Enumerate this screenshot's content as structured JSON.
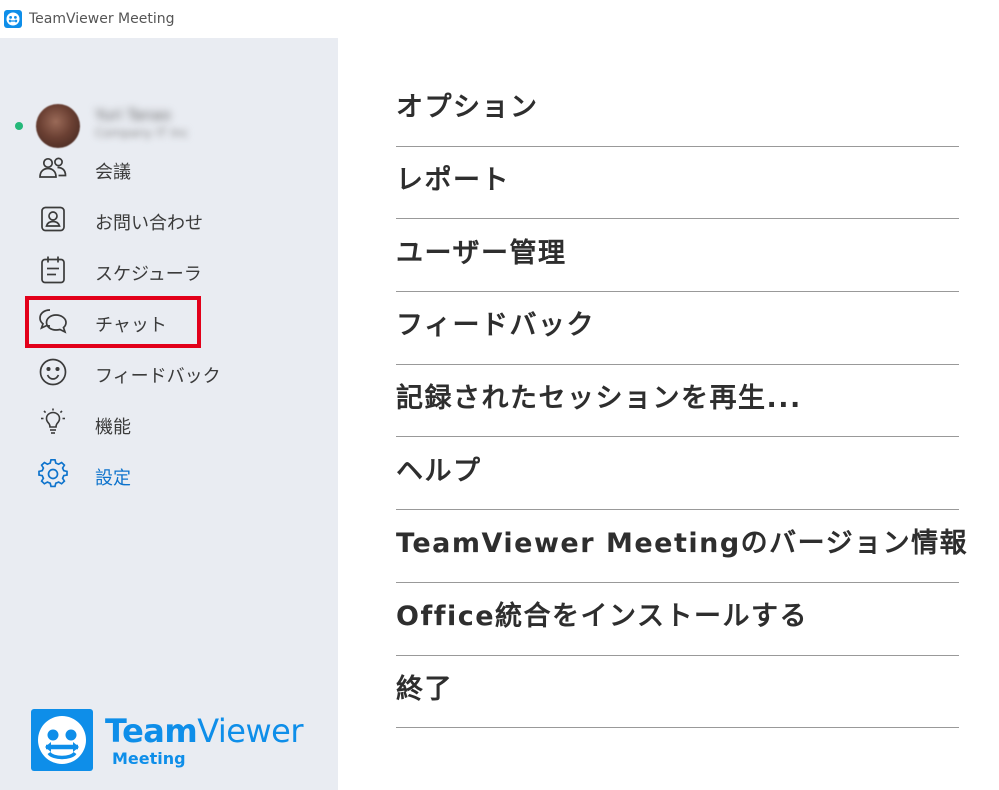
{
  "titlebar": {
    "title": "TeamViewer Meeting",
    "icon": "teamviewer-app-icon"
  },
  "profile": {
    "name": "Yuri Tanao",
    "company": "Company IT Inc",
    "status_color": "#25b87a"
  },
  "sidebar": {
    "items": [
      {
        "label": "会議",
        "icon": "people-icon"
      },
      {
        "label": "お問い合わせ",
        "icon": "contact-card-icon"
      },
      {
        "label": "スケジューラ",
        "icon": "calendar-icon"
      },
      {
        "label": "チャット",
        "icon": "chat-bubbles-icon"
      },
      {
        "label": "フィードバック",
        "icon": "smiley-icon"
      },
      {
        "label": "機能",
        "icon": "lightbulb-icon"
      },
      {
        "label": "設定",
        "icon": "gear-icon",
        "active": true
      }
    ]
  },
  "brand": {
    "word_bold": "Team",
    "word_regular": "Viewer",
    "sub": "Meeting",
    "color": "#0e8ee9"
  },
  "menu": {
    "items": [
      "オプション",
      "レポート",
      "ユーザー管理",
      "フィードバック",
      "記録されたセッションを再生...",
      "ヘルプ",
      "TeamViewer Meetingのバージョン情報",
      "Office統合をインストールする",
      "終了"
    ]
  },
  "colors": {
    "sidebar_bg": "#e9ecf2",
    "accent": "#0e73cc",
    "highlight": "#e2001a"
  }
}
